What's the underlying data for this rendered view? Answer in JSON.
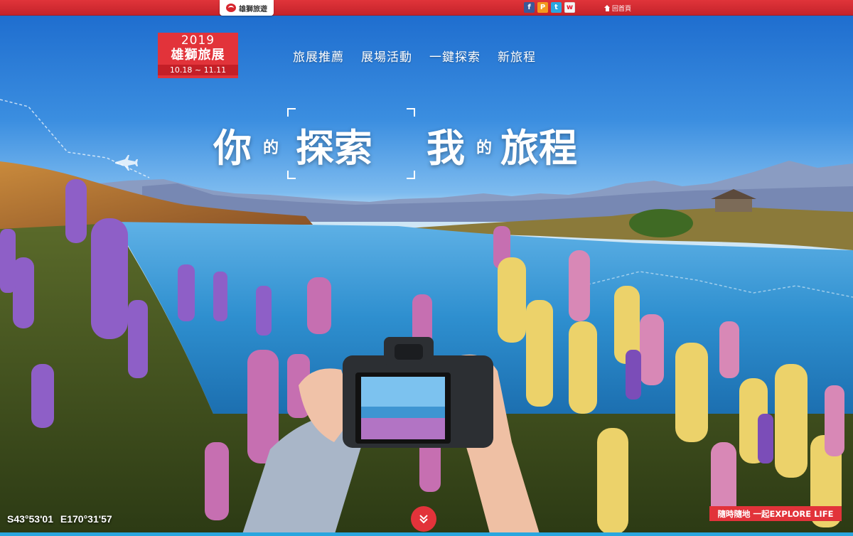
{
  "topbar": {
    "brand": "雄獅旅遊",
    "socials": [
      {
        "name": "facebook-icon",
        "glyph": "f",
        "cls": "fb"
      },
      {
        "name": "plurk-icon",
        "glyph": "P",
        "cls": "pl"
      },
      {
        "name": "twitter-icon",
        "glyph": "t",
        "cls": "tw"
      },
      {
        "name": "weibo-icon",
        "glyph": "w",
        "cls": "wb"
      }
    ],
    "home_label": "回首頁"
  },
  "badge": {
    "year": "2019",
    "name": "雄獅旅展",
    "dates": "10.18 ~ 11.11"
  },
  "nav": [
    "旅展推薦",
    "展場活動",
    "一鍵探索",
    "新旅程"
  ],
  "headline": {
    "word1": "你",
    "particle1": "的",
    "word2": "探索",
    "word3": "我",
    "particle2": "的",
    "word4": "旅程"
  },
  "coordinates": {
    "south": "S43°53'01",
    "east": "E170°31'57"
  },
  "slogan": "隨時隨地 一起EXPLORE LIFE",
  "colors": {
    "brand_red": "#e2333a",
    "accent_blue": "#2aa6df"
  }
}
